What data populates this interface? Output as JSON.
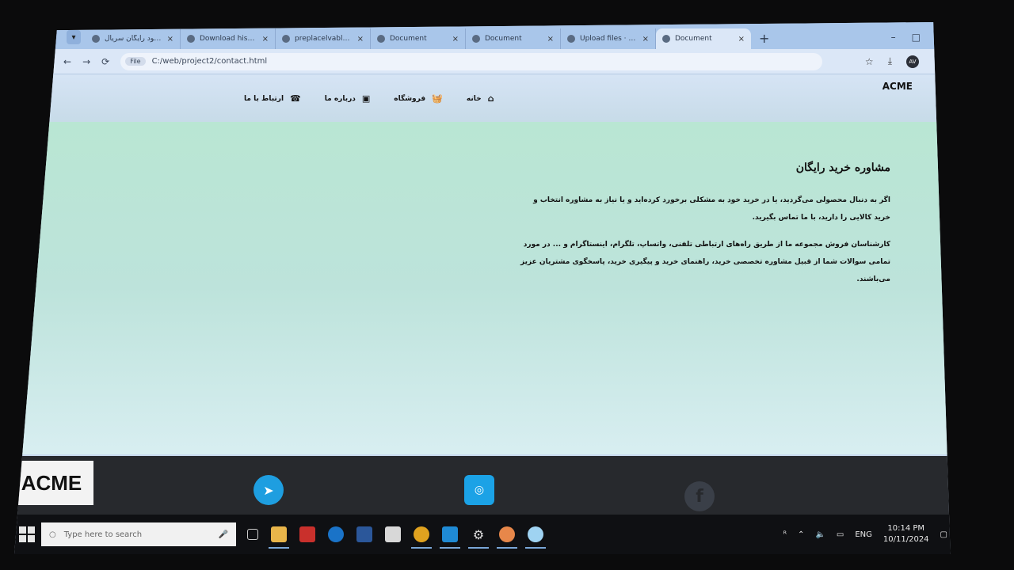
{
  "browser": {
    "tabs": [
      {
        "title": "دانلود رایگان سریال ...",
        "close": "×"
      },
      {
        "title": "Download history",
        "close": "×"
      },
      {
        "title": "preplacelvable.type",
        "close": "×"
      },
      {
        "title": "Document",
        "close": "×"
      },
      {
        "title": "Document",
        "close": "×"
      },
      {
        "title": "Upload files · admin",
        "close": "×"
      },
      {
        "title": "Document",
        "close": "×"
      }
    ],
    "new_tab": "+",
    "window_controls": [
      "–",
      "□",
      "✕"
    ],
    "nav": {
      "back": "←",
      "forward": "→",
      "reload": "⟳"
    },
    "file_chip": "File",
    "url": "C:/web/project2/contact.html",
    "star": "☆",
    "download": "⤓",
    "profile": "AV",
    "menu": "⋮"
  },
  "site": {
    "brand": "ACME",
    "nav": [
      {
        "label": "خانه",
        "icon": "home-icon",
        "glyph": "⌂"
      },
      {
        "label": "فروشگاه",
        "icon": "basket-icon",
        "glyph": "🧺"
      },
      {
        "label": "درباره ما",
        "icon": "id-card-icon",
        "glyph": "▣"
      },
      {
        "label": "ارتباط با ما",
        "icon": "phone-icon",
        "glyph": "☎"
      }
    ],
    "heading": "مشاوره خرید رایگان",
    "paragraph_1": "اگر به دنبال محصولی می‌گردید، یا در خرید خود به مشکلی برخورد کرده‌اید و یا نیاز به مشاوره انتخاب و خرید کالایی را دارید، با ما تماس بگیرید.",
    "paragraph_2": "کارشناسان فروش مجموعه ما از طریق راه‌های ارتباطی تلفنی، واتساپ، تلگرام، اینستاگرام و ... در مورد تمامی سوالات شما از قبیل مشاوره تخصصی خرید، راهنمای خرید و پیگیری خرید، پاسخگوی مشتریان عزیز می‌باشند.",
    "footer": {
      "brand": "ACME",
      "social": [
        {
          "name": "telegram-icon",
          "glyph": "➤"
        },
        {
          "name": "instagram-icon",
          "glyph": "◎"
        },
        {
          "name": "facebook-icon",
          "glyph": "f"
        }
      ]
    }
  },
  "taskbar": {
    "search_placeholder": "Type here to search",
    "apps": [
      "task-view",
      "file-explorer",
      "acrobat",
      "edge",
      "word",
      "store",
      "chrome",
      "vscode",
      "settings",
      "paint",
      "app"
    ],
    "language": "ENG",
    "time": "10:14 PM",
    "date": "10/11/2024"
  },
  "colors": {
    "content_bg": "#b9e6d3",
    "footer_bg": "#27292d",
    "telegram": "#1e9ee0",
    "instagram": "#1ba2e6"
  }
}
